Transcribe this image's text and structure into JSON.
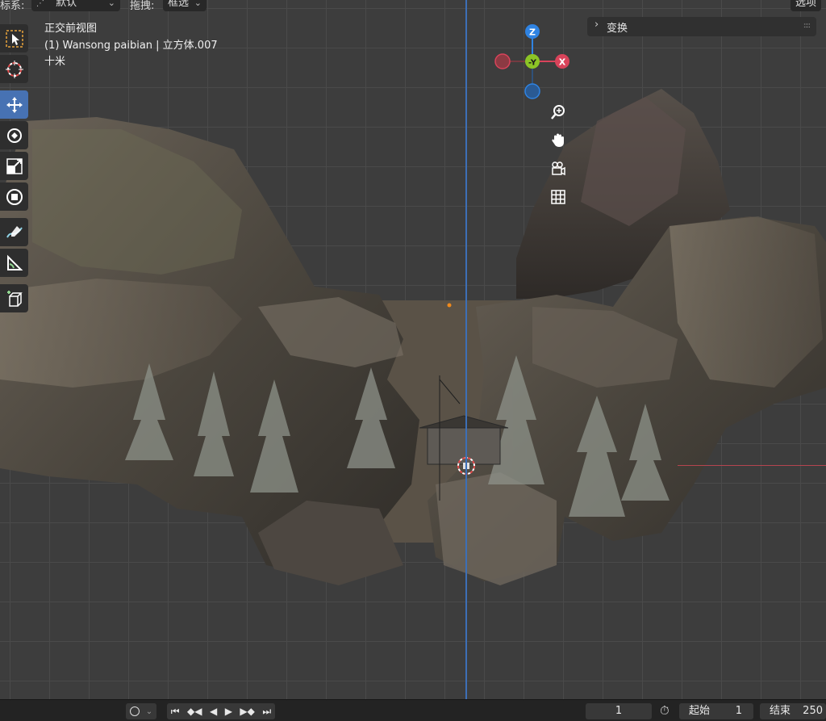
{
  "header": {
    "coord_label": "标系:",
    "coord_value": "默认",
    "drag_label": "拖拽:",
    "drag_value": "框选",
    "options_label": "选项"
  },
  "viewport": {
    "view_name": "正交前视图",
    "object_info": "(1) Wansong paibian | 立方体.007",
    "scale_label": "十米"
  },
  "gizmo": {
    "z_label": "Z",
    "y_label": "-Y",
    "x_label": "X",
    "colors": {
      "x": "#d9435a",
      "y": "#8cc526",
      "z": "#2f83e2",
      "x_neg": "#8c3a43",
      "z_neg": "#2a5a93"
    }
  },
  "nav_icons": [
    "zoom-icon",
    "pan-hand-icon",
    "camera-icon",
    "grid-icon"
  ],
  "toolbar": {
    "tools": [
      "select-box-icon",
      "cursor-icon",
      "move-icon",
      "rotate-icon",
      "scale-icon",
      "transform-icon",
      "annotate-icon",
      "measure-icon",
      "add-cube-icon"
    ],
    "active_tool": "move-icon"
  },
  "sidebar": {
    "transform_title": "变换"
  },
  "timeline": {
    "current_frame": "1",
    "start_label": "起始",
    "start_value": "1",
    "end_label": "结束",
    "end_value": "250"
  },
  "colors": {
    "accent": "#4772b3",
    "axis_z": "#3d6fb6",
    "axis_x": "#b5454f"
  }
}
